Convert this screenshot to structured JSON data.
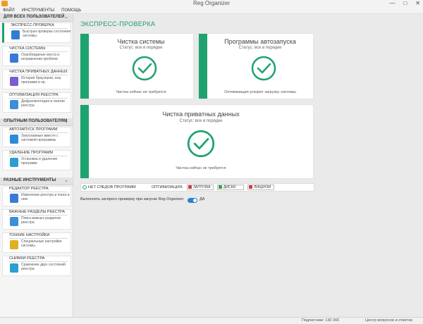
{
  "window": {
    "title": "Reg Organizer",
    "min": "—",
    "max": "□",
    "close": "✕"
  },
  "menu": [
    "Файл",
    "Инструменты",
    "Помощь"
  ],
  "sidebar": {
    "sections": [
      {
        "label": "Для всех пользователей",
        "items": [
          {
            "title": "Экспресс-проверка",
            "desc": "Быстрая проверка состояния системы",
            "icon": "check-magnifier-icon",
            "color": "#2f7fd0",
            "active": true
          },
          {
            "title": "Чистка системы",
            "desc": "Освобождение места и исправление проблем",
            "icon": "broom-icon",
            "color": "#3a7ad6"
          },
          {
            "title": "Чистка приватных данных",
            "desc": "История браузеров, кэш программ и пр.",
            "icon": "private-data-icon",
            "color": "#7a5bd0"
          },
          {
            "title": "Оптимизация реестра",
            "desc": "Дефрагментация и сжатие реестра",
            "icon": "registry-optimize-icon",
            "color": "#3a8fd6"
          }
        ]
      },
      {
        "label": "Опытным пользователям",
        "items": [
          {
            "title": "Автозапуск программ",
            "desc": "Запускаемые вместе с системой программы",
            "icon": "autorun-icon",
            "color": "#2e8bd8"
          },
          {
            "title": "Удаление программ",
            "desc": "Установка и удаление программ",
            "icon": "uninstall-icon",
            "color": "#2a9fd0"
          }
        ]
      },
      {
        "label": "Разные инструменты",
        "items": [
          {
            "title": "Редактор реестра",
            "desc": "Изменение реестра и поиск в нем",
            "icon": "registry-editor-icon",
            "color": "#3a7ad6"
          },
          {
            "title": "Важные разделы реестра",
            "desc": "Поиск важных разделов реестра",
            "icon": "important-keys-icon",
            "color": "#3a8fd6"
          },
          {
            "title": "Тонкие настройки",
            "desc": "Специальные настройки системы",
            "icon": "tweaks-icon",
            "color": "#e0b020"
          },
          {
            "title": "Снимки реестра",
            "desc": "Сравнение двух состояний реестра",
            "icon": "snapshots-icon",
            "color": "#2a9fd0"
          }
        ]
      }
    ]
  },
  "main": {
    "title": "ЭКСПРЕСС-ПРОВЕРКА",
    "cards": [
      {
        "title": "Чистка системы",
        "status": "Статус: все в порядке",
        "foot": "Чистка сейчас не требуется"
      },
      {
        "title": "Программы автозапуска",
        "status": "Статус: все в порядке",
        "foot": "Оптимизация ускорит загрузку системы"
      },
      {
        "title": "Чистка приватных данных",
        "status": "Статус: все в порядке",
        "foot": "Чистка сейчас не требуется"
      }
    ],
    "actions": {
      "no_traces": "НЕТ СЛЕДОВ ПРОГРАММ",
      "opt_label": "ОПТИМИЗАЦИЯ:",
      "opt_items": [
        {
          "label": "ЗАГРУЗКА",
          "color": "#d23a3a"
        },
        {
          "label": "ДИСКИ",
          "color": "#3aa04a"
        },
        {
          "label": "ЛИЦЕНЗИ",
          "color": "#d23a3a"
        }
      ]
    },
    "toggle": {
      "text": "Выполнять экспресс-проверку при запуске Reg Organizer",
      "value": "ДА",
      "on": true
    }
  },
  "status": {
    "left": "Подписчики: 130 365",
    "right": "Центр вопросов и ответов"
  }
}
